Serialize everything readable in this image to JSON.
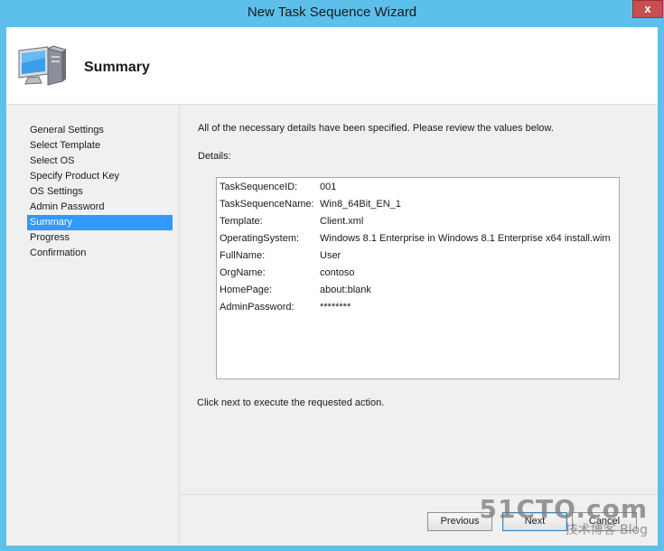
{
  "window": {
    "title": "New Task Sequence Wizard",
    "close_glyph": "x"
  },
  "header": {
    "title": "Summary",
    "icon": "computer-icon"
  },
  "nav": {
    "items": [
      {
        "label": "General Settings",
        "selected": false
      },
      {
        "label": "Select Template",
        "selected": false
      },
      {
        "label": "Select OS",
        "selected": false
      },
      {
        "label": "Specify Product Key",
        "selected": false
      },
      {
        "label": "OS Settings",
        "selected": false
      },
      {
        "label": "Admin Password",
        "selected": false
      },
      {
        "label": "Summary",
        "selected": true
      },
      {
        "label": "Progress",
        "selected": false
      },
      {
        "label": "Confirmation",
        "selected": false
      }
    ]
  },
  "main": {
    "intro": "All of the necessary details have been specified.  Please review the values below.",
    "details_label": "Details:",
    "details": [
      {
        "key": "TaskSequenceID:",
        "value": "001"
      },
      {
        "key": "TaskSequenceName:",
        "value": "Win8_64Bit_EN_1"
      },
      {
        "key": "Template:",
        "value": "Client.xml"
      },
      {
        "key": "OperatingSystem:",
        "value": "Windows 8.1 Enterprise in Windows 8.1 Enterprise x64 install.wim"
      },
      {
        "key": "FullName:",
        "value": "User"
      },
      {
        "key": "OrgName:",
        "value": "contoso"
      },
      {
        "key": "HomePage:",
        "value": "about:blank"
      },
      {
        "key": "AdminPassword:",
        "value": "********"
      }
    ],
    "footer_text": "Click next to execute the requested action."
  },
  "buttons": {
    "previous": "Previous",
    "next": "Next",
    "cancel": "Cancel"
  },
  "watermark": {
    "line1": "51CTO.com",
    "line2": "技术博客 Blog"
  },
  "colors": {
    "frame": "#5cc0ea",
    "selection": "#3399ff"
  }
}
